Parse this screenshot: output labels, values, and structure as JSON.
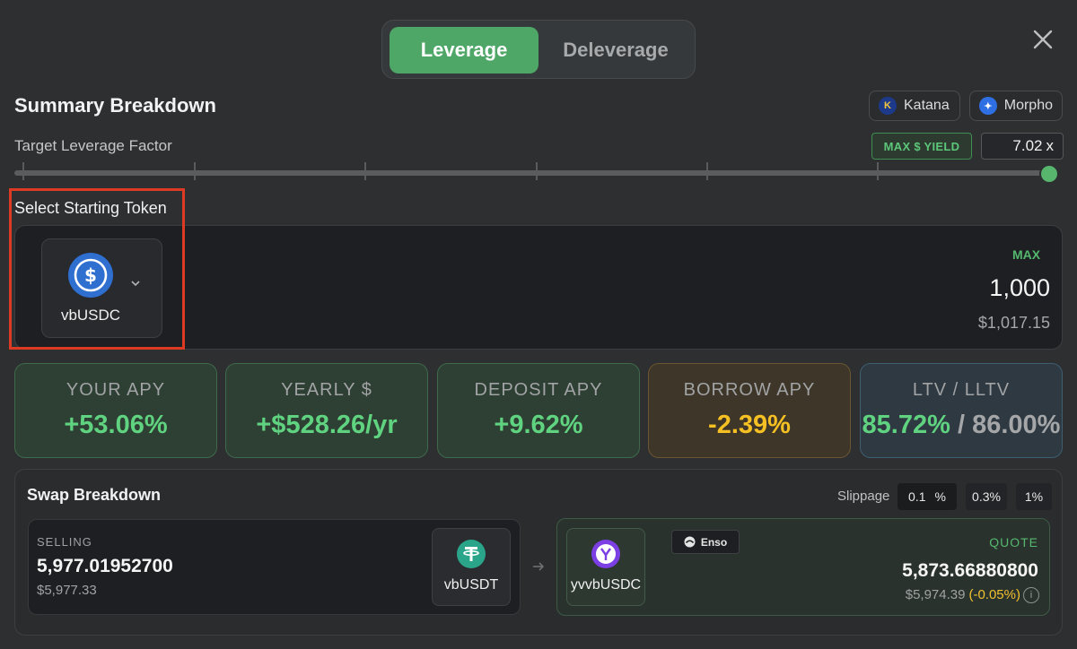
{
  "toggle": {
    "leverage": "Leverage",
    "deleverage": "Deleverage",
    "active": "Leverage"
  },
  "header": {
    "title": "Summary Breakdown"
  },
  "protocols": [
    {
      "name": "Katana",
      "icon": "katana-icon",
      "color": "#f5c73b"
    },
    {
      "name": "Morpho",
      "icon": "morpho-icon",
      "color": "#2f6fe4"
    }
  ],
  "leverage": {
    "label": "Target Leverage Factor",
    "max_yield_label": "MAX $ YIELD",
    "value": "7.02",
    "unit": "x",
    "slider_fraction": 1.0
  },
  "starting_token": {
    "label": "Select Starting Token",
    "token": "vbUSDC",
    "max_label": "MAX",
    "amount": "1,000",
    "usd_value": "$1,017.15"
  },
  "stats": [
    {
      "label": "YOUR APY",
      "value": "+53.06%",
      "color": "#5fd37f"
    },
    {
      "label": "YEARLY $",
      "value": "+$528.26/yr",
      "color": "#5fd37f"
    },
    {
      "label": "DEPOSIT APY",
      "value": "+9.62%",
      "color": "#5fd37f"
    },
    {
      "label": "BORROW APY",
      "value": "-2.39%",
      "color": "#f5c023"
    },
    {
      "label": "LTV / LLTV",
      "value_ltv": "85.72%",
      "separator": " / ",
      "value_lltv": "86.00%",
      "color": "#5fd37f"
    }
  ],
  "swap": {
    "title": "Swap Breakdown",
    "slippage_label": "Slippage",
    "slippage_options": [
      "0.1",
      "%",
      "0.3%",
      "1%"
    ],
    "selling": {
      "label": "SELLING",
      "amount": "5,977.01952700",
      "usd": "$5,977.33",
      "token": "vbUSDT"
    },
    "quote": {
      "provider": "Enso",
      "label": "QUOTE",
      "token": "yvvbUSDC",
      "amount": "5,873.66880800",
      "usd": "$5,974.39",
      "price_impact": "(-0.05%)",
      "info": "i"
    }
  }
}
